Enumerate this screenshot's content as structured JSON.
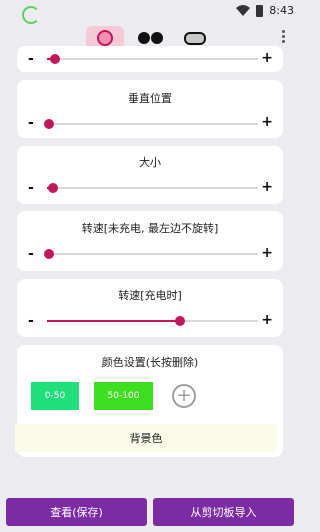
{
  "status_bar": {
    "time": "8:43"
  },
  "toolbar": {
    "tabs": [
      {
        "icon": "ring-icon",
        "selected": true
      },
      {
        "icon": "glasses-icon",
        "selected": false
      },
      {
        "icon": "pill-icon",
        "selected": false
      }
    ]
  },
  "sliders": [
    {
      "title": "",
      "value_fraction": 0.04
    },
    {
      "title": "垂直位置",
      "value_fraction": 0.01
    },
    {
      "title": "大小",
      "value_fraction": 0.03
    },
    {
      "title": "转速[未充电, 最左边不旋转]",
      "value_fraction": 0.01
    },
    {
      "title": "转速[充电时]",
      "value_fraction": 0.63
    }
  ],
  "slider_controls": {
    "minus": "-",
    "plus": "+"
  },
  "color_settings": {
    "title": "颜色设置(长按删除)",
    "ranges": [
      {
        "label": "0-50",
        "color": "#20e07a"
      },
      {
        "label": "50-100",
        "color": "#3ede20"
      }
    ],
    "add_symbol": "+",
    "background_label": "背景色"
  },
  "buttons": {
    "view_save": "查看(保存)",
    "import_clipboard": "从剪切板导入"
  },
  "colors": {
    "accent": "#c2185b",
    "button": "#7b2ca3"
  }
}
